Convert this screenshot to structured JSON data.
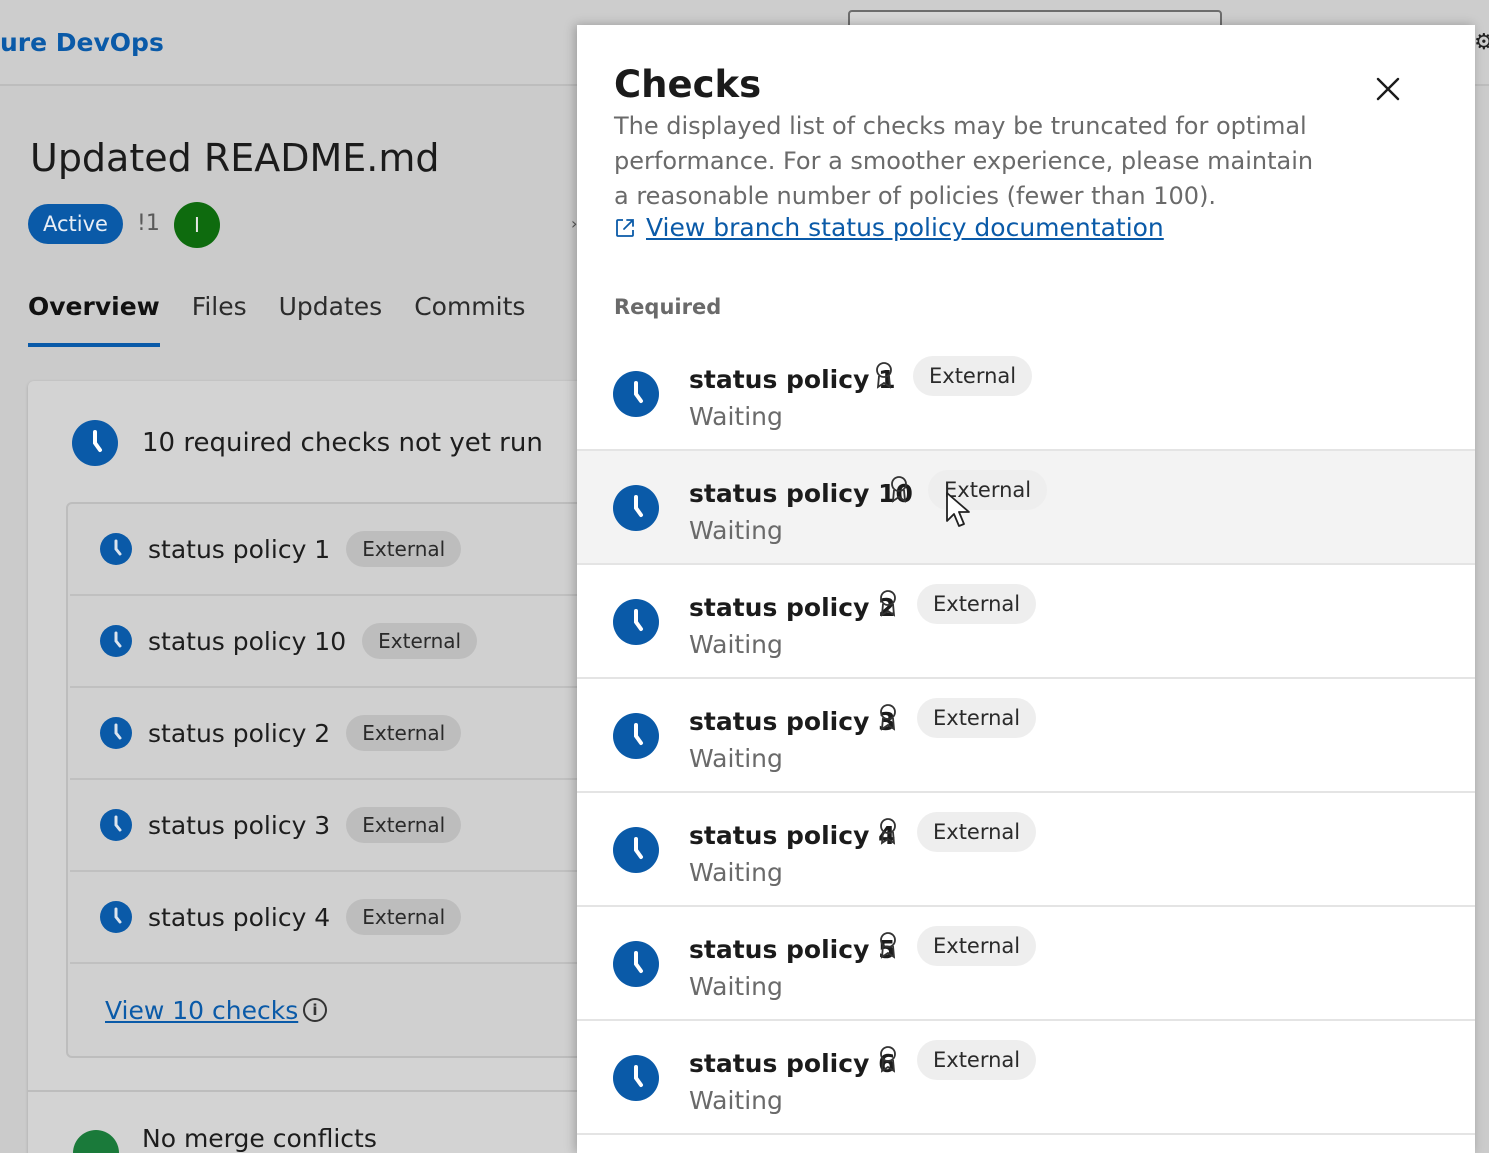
{
  "app": {
    "brand": "ure DevOps"
  },
  "pr": {
    "title": "Updated README.md",
    "status": "Active",
    "count_label": "!1",
    "avatar_initial": "I"
  },
  "tabs": [
    {
      "label": "Overview",
      "active": true
    },
    {
      "label": "Files",
      "active": false
    },
    {
      "label": "Updates",
      "active": false
    },
    {
      "label": "Commits",
      "active": false
    }
  ],
  "summary": {
    "heading": "10 required checks not yet run",
    "items": [
      {
        "name": "status policy 1",
        "tag": "External"
      },
      {
        "name": "status policy 10",
        "tag": "External"
      },
      {
        "name": "status policy 2",
        "tag": "External"
      },
      {
        "name": "status policy 3",
        "tag": "External"
      },
      {
        "name": "status policy 4",
        "tag": "External"
      }
    ],
    "view_link": "View 10 checks",
    "merge_text": "No merge conflicts"
  },
  "panel": {
    "title": "Checks",
    "description": "The displayed list of checks may be truncated for optimal performance. For a smoother experience, please maintain a reasonable number of policies (fewer than 100).",
    "doc_link": "View branch status policy documentation",
    "section": "Required",
    "checks": [
      {
        "name": "status policy 1",
        "state": "Waiting",
        "tag": "External"
      },
      {
        "name": "status policy 10",
        "state": "Waiting",
        "tag": "External"
      },
      {
        "name": "status policy 2",
        "state": "Waiting",
        "tag": "External"
      },
      {
        "name": "status policy 3",
        "state": "Waiting",
        "tag": "External"
      },
      {
        "name": "status policy 4",
        "state": "Waiting",
        "tag": "External"
      },
      {
        "name": "status policy 5",
        "state": "Waiting",
        "tag": "External"
      },
      {
        "name": "status policy 6",
        "state": "Waiting",
        "tag": "External"
      }
    ]
  },
  "icons": {
    "clock": "clock-icon",
    "close": "close-icon",
    "external_link": "external-link-icon",
    "ribbon": "ribbon-icon",
    "info": "info-icon",
    "settings": "gear-icon",
    "cursor": "mouse-cursor"
  },
  "colors": {
    "accent": "#0a5aa8",
    "avatar": "#0e6b0e",
    "success": "#1a7a3a"
  }
}
